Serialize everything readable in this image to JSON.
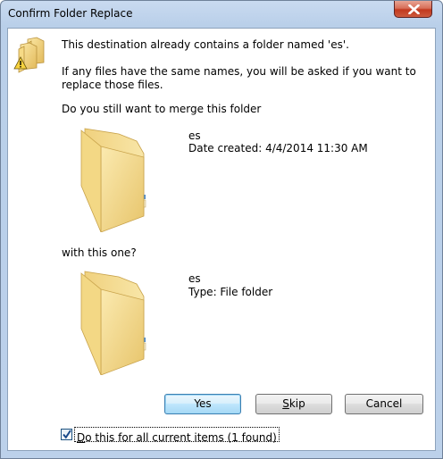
{
  "window": {
    "title": "Confirm Folder Replace"
  },
  "message": {
    "line1": "This destination already contains a folder named 'es'.",
    "line2": "If any files have the same names, you will be asked if you want to replace those files.",
    "question": "Do you still want to merge this folder"
  },
  "source_folder": {
    "name": "es",
    "detail": "Date created: 4/4/2014 11:30 AM"
  },
  "with_label": "with this one?",
  "target_folder": {
    "name": "es",
    "detail": "Type: File folder"
  },
  "buttons": {
    "yes": "Yes",
    "skip_accel": "S",
    "skip_rest": "kip",
    "cancel": "Cancel"
  },
  "checkbox": {
    "checked": true,
    "accel": "D",
    "label_rest": "o this for all current items (1 found)"
  },
  "icons": {
    "header": "folders-warning-icon",
    "folder": "folder-icon"
  },
  "colors": {
    "folder_yellow": "#f4d77c",
    "default_button_border": "#3c7fb1",
    "close_button": "#c2391f"
  }
}
